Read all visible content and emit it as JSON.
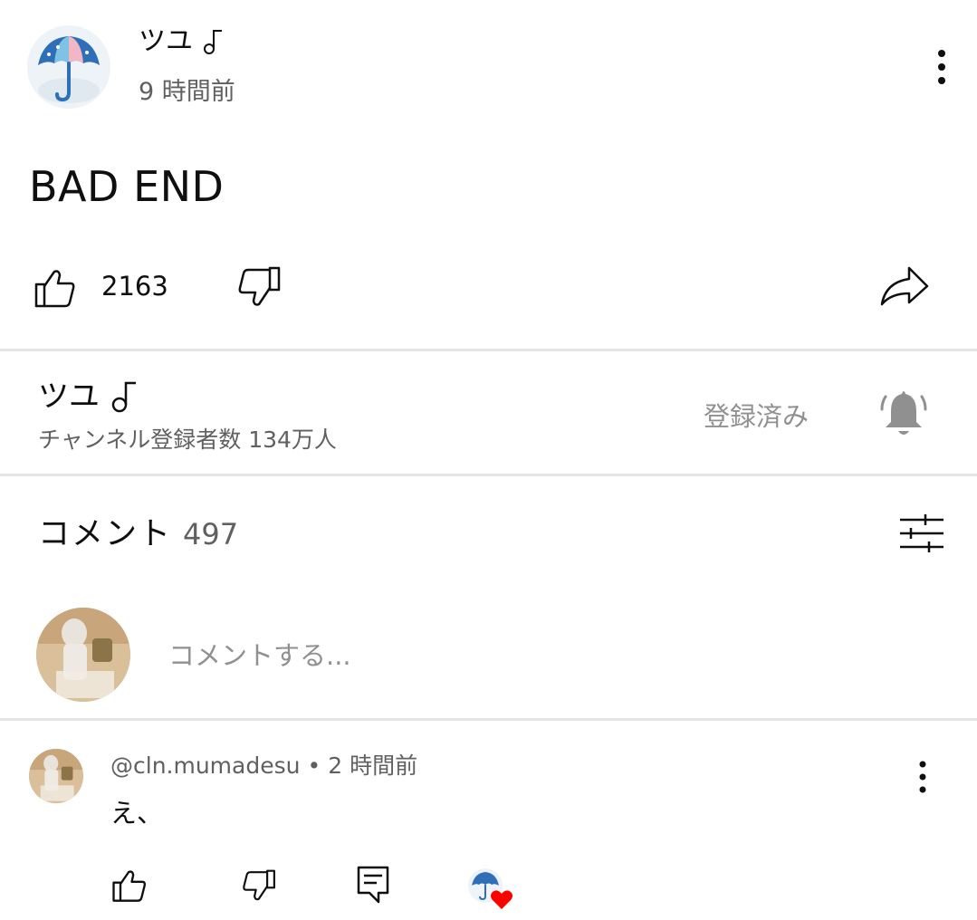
{
  "post": {
    "author": "ツユ",
    "time": "9 時間前",
    "body": "BAD END",
    "like_count": "2163"
  },
  "channel": {
    "name": "ツユ",
    "subscribers": "チャンネル登録者数 134万人",
    "subscribed_label": "登録済み"
  },
  "comments": {
    "title": "コメント",
    "count": "497",
    "input_placeholder": "コメントする...",
    "items": [
      {
        "author": "@cln.mumadesu",
        "separator": "•",
        "time": "2 時間前",
        "text": "え、"
      }
    ]
  },
  "icons": {
    "note": "music-note-icon",
    "more": "more-vert-icon",
    "like": "thumb-up-icon",
    "dislike": "thumb-down-icon",
    "share": "share-icon",
    "bell": "bell-icon",
    "sort": "tune-icon",
    "reply": "reply-icon",
    "heart": "creator-heart-icon"
  },
  "colors": {
    "text_primary": "#0f0f0f",
    "text_secondary": "#606060",
    "text_muted": "#909090",
    "divider": "#e5e5e5",
    "heart": "#ff0000"
  }
}
